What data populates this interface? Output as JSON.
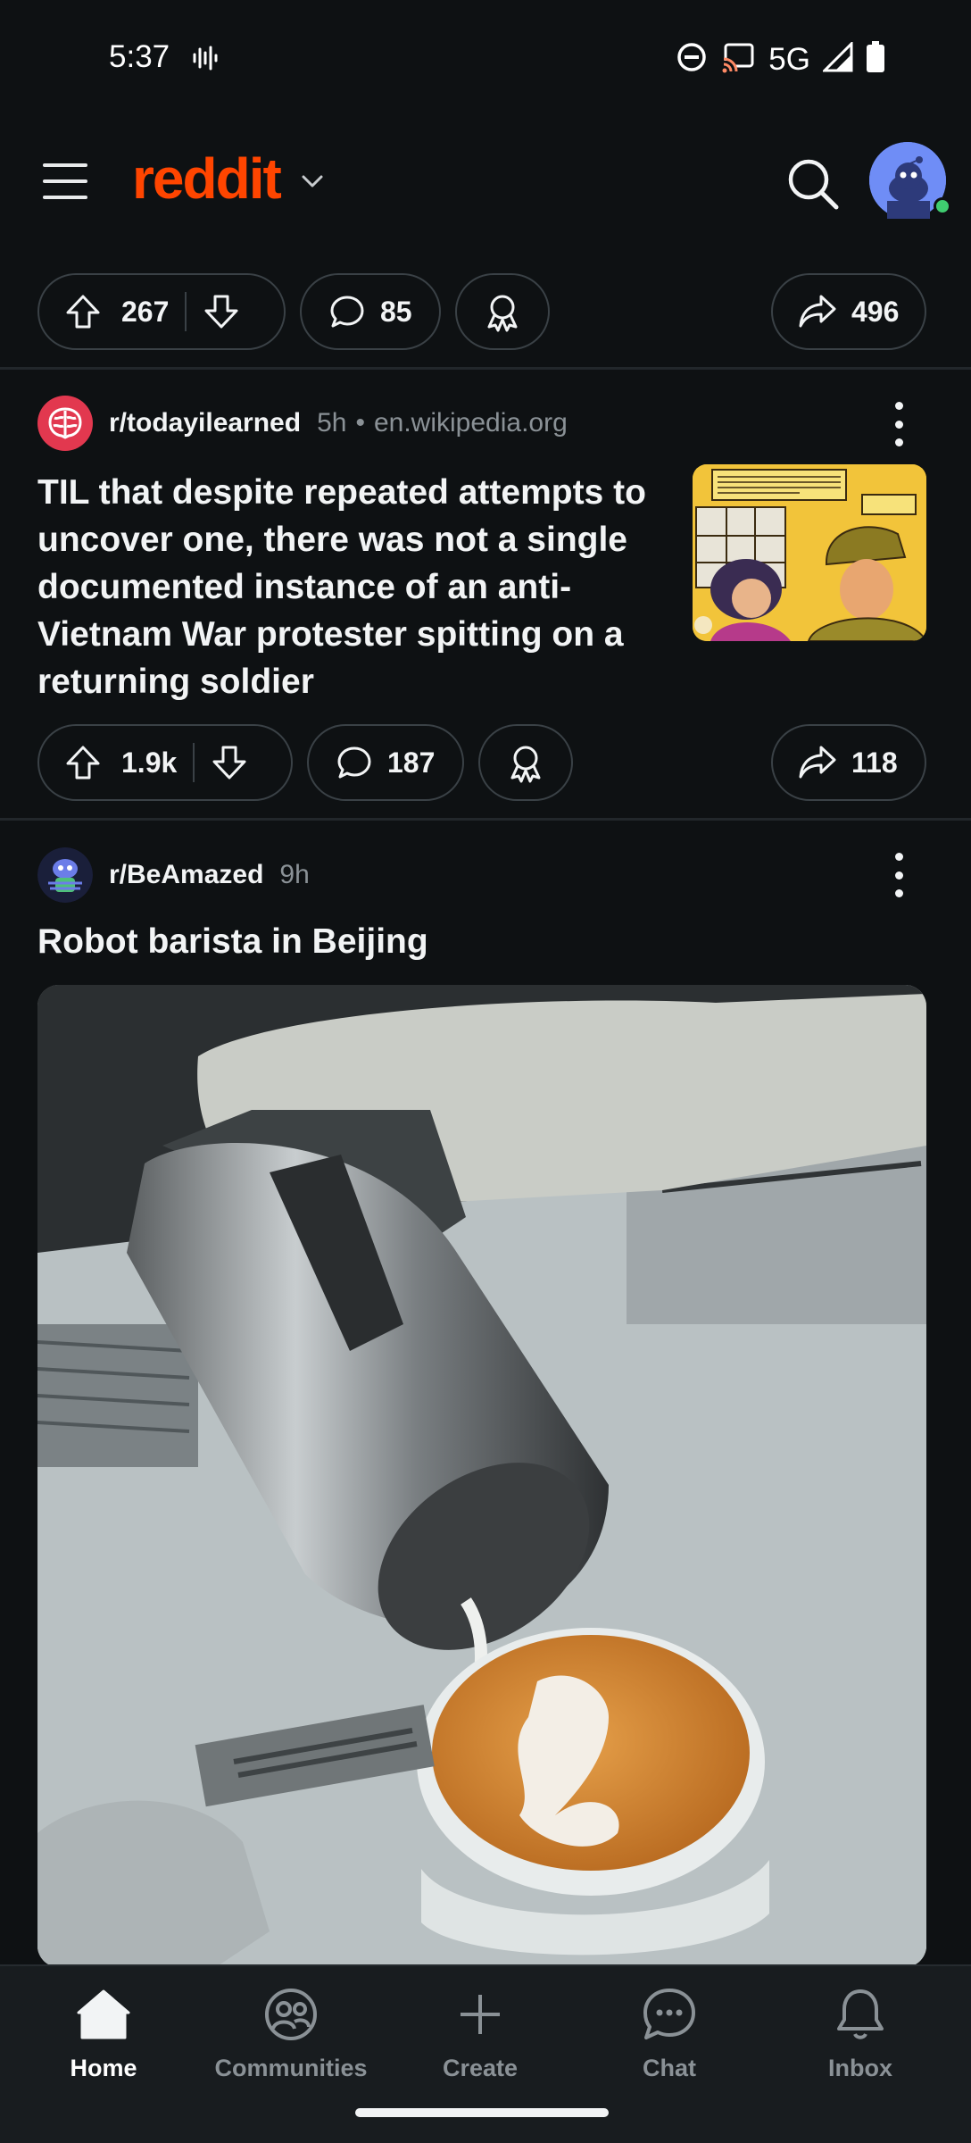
{
  "status_bar": {
    "time": "5:37",
    "network": "5G"
  },
  "header": {
    "logo": "reddit"
  },
  "prev_post_actions": {
    "upvotes": "267",
    "comments": "85",
    "shares": "496"
  },
  "posts": [
    {
      "subreddit": "r/todayilearned",
      "age": "5h",
      "domain": "en.wikipedia.org",
      "title": "TIL that despite repeated attempts to uncover one, there was not a single documented instance of an anti-Vietnam War protester spitting on a returning soldier",
      "upvotes": "1.9k",
      "comments": "187",
      "shares": "118"
    },
    {
      "subreddit": "r/BeAmazed",
      "age": "9h",
      "title": "Robot barista in Beijing"
    }
  ],
  "bottom_nav": [
    {
      "label": "Home",
      "icon": "home-icon",
      "active": true
    },
    {
      "label": "Communities",
      "icon": "communities-icon"
    },
    {
      "label": "Create",
      "icon": "plus-icon"
    },
    {
      "label": "Chat",
      "icon": "chat-icon"
    },
    {
      "label": "Inbox",
      "icon": "bell-icon"
    }
  ],
  "colors": {
    "brand": "#ff4500",
    "background": "#0e1113",
    "muted_text": "#8a9196"
  }
}
